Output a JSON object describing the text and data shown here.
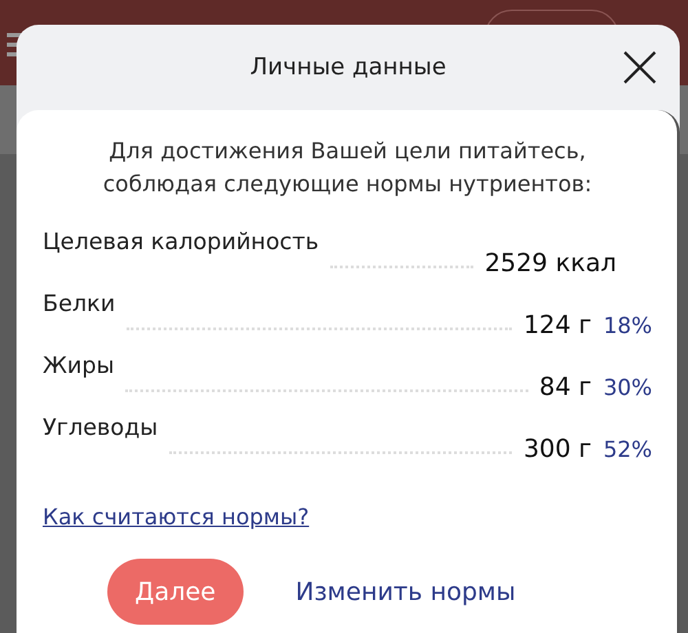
{
  "dialog": {
    "title": "Личные данные",
    "intro": "Для достижения Вашей цели питайтесь,\nсоблюдая следующие нормы нутриентов:",
    "rows": [
      {
        "label": "Целевая калорийность",
        "value": "2529 ккал"
      },
      {
        "label": "Белки",
        "value": "124 г",
        "percent": "18%"
      },
      {
        "label": "Жиры",
        "value": "84 г",
        "percent": "30%"
      },
      {
        "label": "Углеводы",
        "value": "300 г",
        "percent": "52%"
      }
    ],
    "link": "Как считаются нормы?",
    "primary_button": "Далее",
    "secondary_button": "Изменить нормы"
  }
}
